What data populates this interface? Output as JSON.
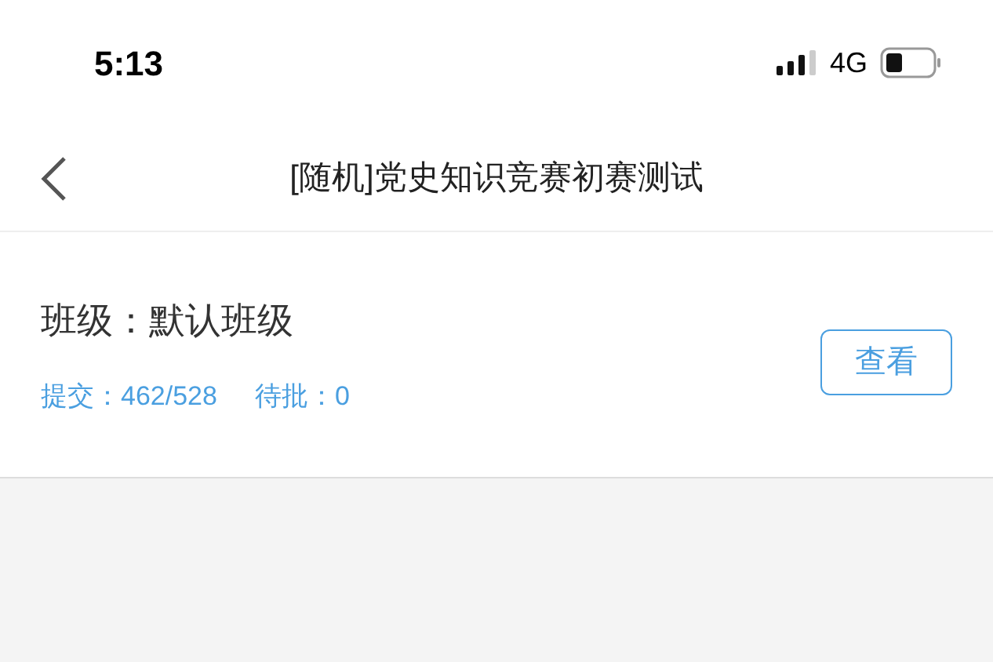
{
  "status_bar": {
    "time": "5:13",
    "network": "4G"
  },
  "nav_bar": {
    "title": "[随机]党史知识竞赛初赛测试"
  },
  "class_card": {
    "class_name": "班级：默认班级",
    "submitted": "提交：462/528",
    "pending": "待批：0",
    "view_button": "查看"
  }
}
